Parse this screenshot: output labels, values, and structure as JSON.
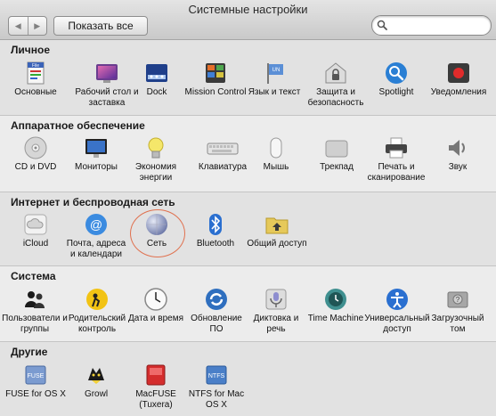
{
  "window": {
    "title": "Системные настройки",
    "back_icon": "chevron-left-icon",
    "forward_icon": "chevron-right-icon",
    "show_all_label": "Показать все",
    "search": {
      "value": "",
      "placeholder": ""
    }
  },
  "sections": [
    {
      "title": "Личное",
      "items": [
        {
          "label": "Основные",
          "icon": "general-icon"
        },
        {
          "label": "Рабочий стол и заставка",
          "icon": "desktop-screensaver-icon"
        },
        {
          "label": "Dock",
          "icon": "dock-icon"
        },
        {
          "label": "Mission Control",
          "icon": "mission-control-icon"
        },
        {
          "label": "Язык и текст",
          "icon": "language-text-icon"
        },
        {
          "label": "Защита и безопасность",
          "icon": "security-icon"
        },
        {
          "label": "Spotlight",
          "icon": "spotlight-icon"
        },
        {
          "label": "Уведомления",
          "icon": "notifications-icon"
        }
      ]
    },
    {
      "title": "Аппаратное обеспечение",
      "items": [
        {
          "label": "CD и DVD",
          "icon": "cd-dvd-icon"
        },
        {
          "label": "Мониторы",
          "icon": "displays-icon"
        },
        {
          "label": "Экономия энергии",
          "icon": "energy-saver-icon"
        },
        {
          "label": "Клавиатура",
          "icon": "keyboard-icon"
        },
        {
          "label": "Мышь",
          "icon": "mouse-icon"
        },
        {
          "label": "Трекпад",
          "icon": "trackpad-icon"
        },
        {
          "label": "Печать и сканирование",
          "icon": "print-scan-icon"
        },
        {
          "label": "Звук",
          "icon": "sound-icon"
        }
      ]
    },
    {
      "title": "Интернет и беспроводная сеть",
      "items": [
        {
          "label": "iCloud",
          "icon": "icloud-icon"
        },
        {
          "label": "Почта, адреса и календари",
          "icon": "mail-contacts-icon"
        },
        {
          "label": "Сеть",
          "icon": "network-icon"
        },
        {
          "label": "Bluetooth",
          "icon": "bluetooth-icon"
        },
        {
          "label": "Общий доступ",
          "icon": "sharing-icon"
        }
      ]
    },
    {
      "title": "Система",
      "items": [
        {
          "label": "Пользователи и группы",
          "icon": "users-groups-icon"
        },
        {
          "label": "Родительский контроль",
          "icon": "parental-controls-icon"
        },
        {
          "label": "Дата и время",
          "icon": "date-time-icon"
        },
        {
          "label": "Обновление ПО",
          "icon": "software-update-icon"
        },
        {
          "label": "Диктовка и речь",
          "icon": "dictation-speech-icon"
        },
        {
          "label": "Time Machine",
          "icon": "time-machine-icon"
        },
        {
          "label": "Универсальный доступ",
          "icon": "accessibility-icon"
        },
        {
          "label": "Загрузочный том",
          "icon": "startup-disk-icon"
        }
      ]
    },
    {
      "title": "Другие",
      "items": [
        {
          "label": "FUSE for OS X",
          "icon": "fuse-icon"
        },
        {
          "label": "Growl",
          "icon": "growl-icon"
        },
        {
          "label": "MacFUSE (Tuxera)",
          "icon": "macfuse-icon"
        },
        {
          "label": "NTFS for Mac OS X",
          "icon": "ntfs-icon"
        }
      ]
    }
  ],
  "icon_text": {
    "general_file": "File",
    "language_flag": "UN",
    "fuse_text": "FUSE",
    "ntfs_text": "NTFS"
  },
  "colors": {
    "highlight_circle": "#e0714f",
    "accent_blue": "#2a7fd4"
  }
}
